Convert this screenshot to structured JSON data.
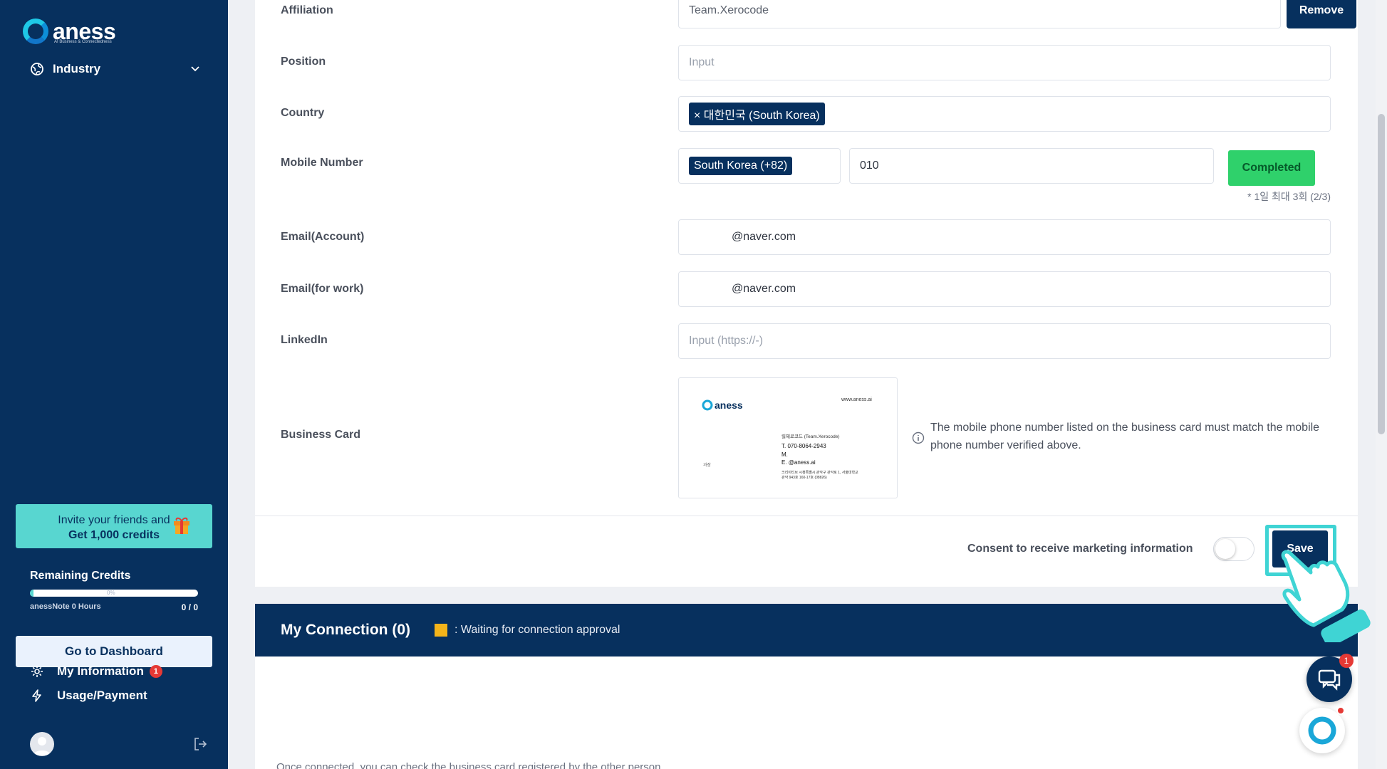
{
  "sidebar": {
    "logo_text": "aness",
    "logo_tagline": "AI Business & Connectedness",
    "industry_label": "Industry",
    "invite_line1": "Invite your friends and",
    "invite_line2": "Get 1,000 credits",
    "credits_title": "Remaining Credits",
    "credits_percent_label": "0%",
    "credits_progress": 0.01,
    "credits_note": "anessNote 0 Hours",
    "credits_value": "0 / 0",
    "dashboard_button": "Go to Dashboard",
    "nav": [
      {
        "label": "My Information",
        "badge": "1",
        "icon": "gear-icon"
      },
      {
        "label": "Usage/Payment",
        "icon": "lightning-icon"
      }
    ]
  },
  "form": {
    "affiliation": {
      "label": "Affiliation",
      "value": "Team.Xerocode",
      "remove_button": "Remove"
    },
    "position": {
      "label": "Position",
      "placeholder": "Input"
    },
    "country": {
      "label": "Country",
      "tag": "× 대한민국 (South Korea)"
    },
    "mobile": {
      "label": "Mobile Number",
      "country_tag": "South Korea (+82)",
      "number": "010",
      "verify_button": "Completed",
      "limit_note": "* 1일 최대 3회 (2/3)"
    },
    "email_account": {
      "label": "Email(Account)",
      "value": "@naver.com"
    },
    "email_work": {
      "label": "Email(for work)",
      "value": "@naver.com"
    },
    "linkedin": {
      "label": "LinkedIn",
      "placeholder": "Input (https://-)"
    },
    "business_card": {
      "label": "Business Card",
      "card_logo": "aness",
      "card_url": "www.aness.ai",
      "card_company": "릴제로코드 (Team.Xerocode)",
      "card_t": "T.  070-8064-2943",
      "card_m": "M.",
      "card_e": "E.              @aness.ai",
      "card_addr1": "크리이티브 시청특별시 관악구 관악로 1, 서울대학교",
      "card_addr2": "관악 943호 160-17호 (08826)",
      "card_role": "과장",
      "note": "The mobile phone number listed on the business card must match the mobile phone number verified above."
    },
    "consent_label": "Consent to receive marketing information",
    "save_button": "Save"
  },
  "connection": {
    "title": "My Connection (0)",
    "legend": ": Waiting for connection approval",
    "note": "Once connected, you can check the business card registered by the other person."
  },
  "floating": {
    "chat_badge": "1"
  },
  "colors": {
    "brand": "#07305e",
    "accent": "#58d6d0",
    "success": "#2fd16b",
    "pending": "#f4b41a"
  }
}
